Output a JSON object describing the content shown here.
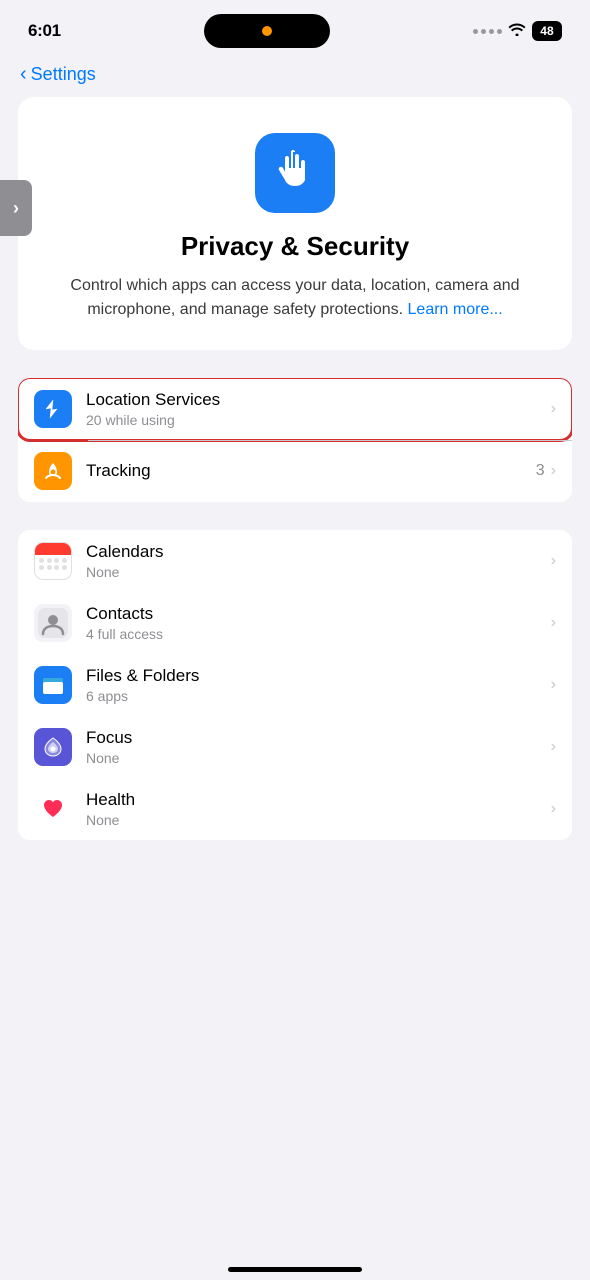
{
  "statusBar": {
    "time": "6:01",
    "battery": "48"
  },
  "navigation": {
    "backLabel": "Settings"
  },
  "heroCard": {
    "title": "Privacy & Security",
    "description": "Control which apps can access your data, location, camera and microphone, and manage safety protections.",
    "learnMoreLabel": "Learn more..."
  },
  "locationServicesItem": {
    "title": "Location Services",
    "subtitle": "20 while using"
  },
  "trackingItem": {
    "title": "Tracking",
    "count": "3"
  },
  "menuItems": [
    {
      "id": "calendars",
      "title": "Calendars",
      "subtitle": "None",
      "iconType": "calendar"
    },
    {
      "id": "contacts",
      "title": "Contacts",
      "subtitle": "4 full access",
      "iconType": "contacts"
    },
    {
      "id": "files",
      "title": "Files & Folders",
      "subtitle": "6 apps",
      "iconType": "files"
    },
    {
      "id": "focus",
      "title": "Focus",
      "subtitle": "None",
      "iconType": "focus"
    },
    {
      "id": "health",
      "title": "Health",
      "subtitle": "None",
      "iconType": "health"
    }
  ]
}
